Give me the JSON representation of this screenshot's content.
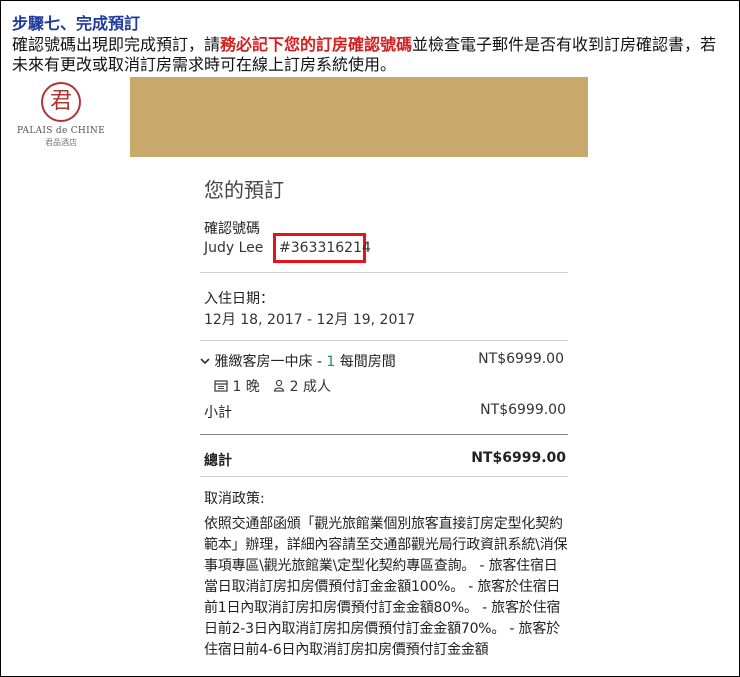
{
  "header": {
    "step_title": "步驟七、完成預訂",
    "intro_pre": "確認號碼出現即完成預訂，請",
    "intro_emph": "務必記下您的訂房確認號碼",
    "intro_post": "並檢查電子郵件是否有收到訂房確認書，若未來有更改或取消訂房需求時可在線上訂房系統使用。"
  },
  "logo": {
    "mark": "君",
    "name": "PALAIS de CHINE",
    "sub": "君品酒店"
  },
  "colors": {
    "banner": "#c9a86b",
    "emphasis": "#d21f1f",
    "step_title": "#1f3a9e",
    "highlight_box": "#e1161c"
  },
  "booking": {
    "title": "您的預訂",
    "confirmation_label": "確認號碼",
    "guest_name": "Judy Lee",
    "confirmation_number": "#363316214",
    "checkin_label": "入住日期：",
    "dates": "12月 18, 2017 - 12月 19, 2017",
    "room_name": "雅緻客房一中床 - ",
    "room_count": "1",
    "room_suffix": " 每間房間",
    "room_price": "NT$6999.00",
    "nights": "1 晚",
    "adults": "2 成人",
    "subtotal_label": "小計",
    "subtotal_value": "NT$6999.00",
    "total_label": "總計",
    "total_value": "NT$6999.00",
    "policy_title": "取消政策:",
    "policy_text": "依照交通部函頒「觀光旅館業個別旅客直接訂房定型化契約範本」辦理，詳細內容請至交通部觀光局行政資訊系統\\消保事項專區\\觀光旅館業\\定型化契約專區查詢。 - 旅客住宿日當日取消訂房扣房價預付訂金金額100%。 - 旅客於住宿日前1日內取消訂房扣房價預付訂金金額80%。 - 旅客於住宿日前2-3日內取消訂房扣房價預付訂金金額70%。 - 旅客於住宿日前4-6日內取消訂房扣房價預付訂金金額"
  }
}
